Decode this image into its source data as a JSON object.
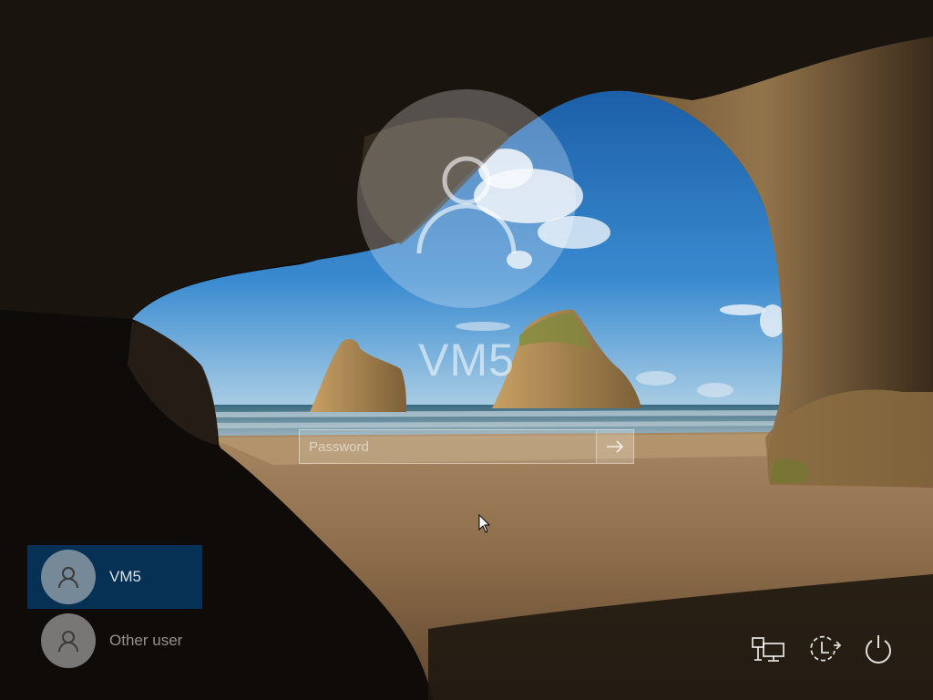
{
  "login": {
    "username": "VM5",
    "password_placeholder": "Password"
  },
  "users": [
    {
      "name": "VM5",
      "selected": true,
      "icon": "user-avatar-icon"
    },
    {
      "name": "Other user",
      "selected": false,
      "icon": "user-avatar-icon"
    }
  ],
  "system_icons": [
    "network-icon",
    "ease-of-access-icon",
    "power-icon"
  ],
  "colors": {
    "selected_user_bg": "#00528f",
    "sky": "#2f7cc4",
    "sand": "#8a6a48"
  }
}
